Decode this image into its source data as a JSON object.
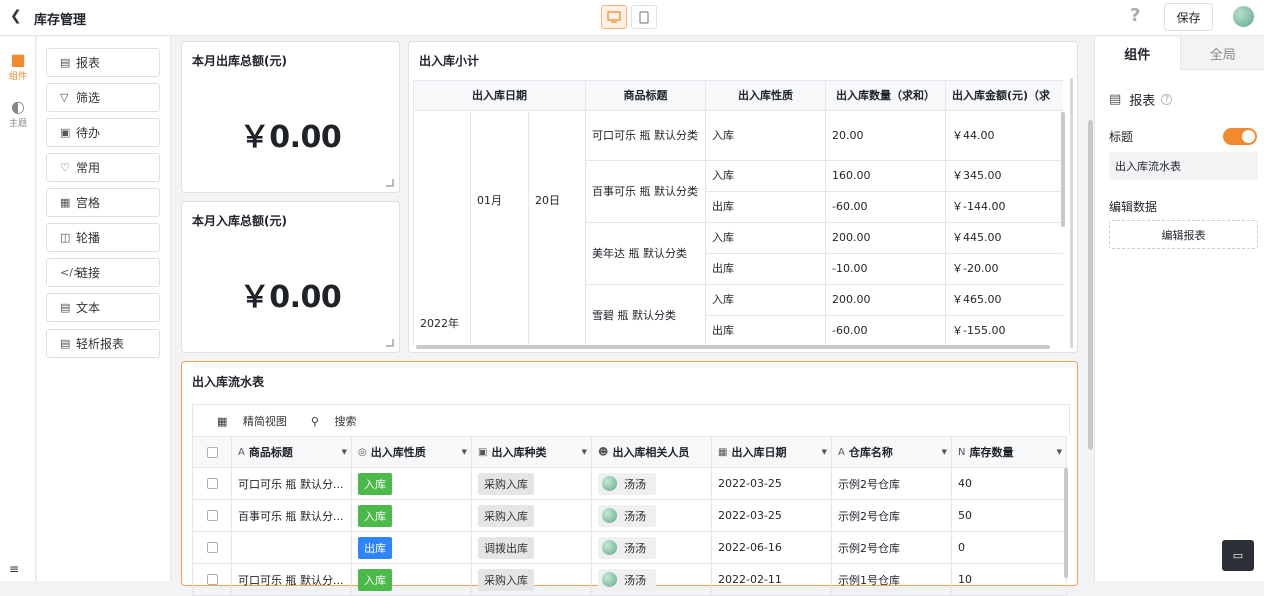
{
  "header": {
    "back_icon": "chevron-left-icon",
    "title": "库存管理",
    "help": "?",
    "save_label": "保存"
  },
  "rail": {
    "items": [
      {
        "label": "组件",
        "icon": "puzzle-icon",
        "active": true
      },
      {
        "label": "主题",
        "icon": "palette-icon",
        "active": false
      }
    ],
    "collapse_icon": "collapse-icon"
  },
  "components": [
    {
      "label": "报表",
      "icon": "report-icon"
    },
    {
      "label": "筛选",
      "icon": "filter-icon"
    },
    {
      "label": "待办",
      "icon": "todo-icon"
    },
    {
      "label": "常用",
      "icon": "heart-icon"
    },
    {
      "label": "宫格",
      "icon": "grid-icon"
    },
    {
      "label": "轮播",
      "icon": "carousel-icon"
    },
    {
      "label": "链接",
      "icon": "link-icon"
    },
    {
      "label": "文本",
      "icon": "text-icon"
    },
    {
      "label": "轻析报表",
      "icon": "analysis-icon"
    }
  ],
  "cards": {
    "out_total": {
      "title": "本月出库总额(元)",
      "value": "￥0.00"
    },
    "in_total": {
      "title": "本月入库总额(元)",
      "value": "￥0.00"
    }
  },
  "summary": {
    "title": "出入库小计",
    "headers": [
      "出入库日期",
      "商品标题",
      "出入库性质",
      "出入库数量（求和）",
      "出入库金额(元)（求"
    ],
    "year": "2022年",
    "month": "01月",
    "day": "20日",
    "groups": [
      {
        "product": "可口可乐 瓶 默认分类",
        "rows": [
          {
            "type": "入库",
            "qty": "20.00",
            "amount": "￥44.00"
          }
        ]
      },
      {
        "product": "百事可乐 瓶 默认分类",
        "rows": [
          {
            "type": "入库",
            "qty": "160.00",
            "amount": "￥345.00"
          },
          {
            "type": "出库",
            "qty": "-60.00",
            "amount": "￥-144.00"
          }
        ]
      },
      {
        "product": "美年达 瓶 默认分类",
        "rows": [
          {
            "type": "入库",
            "qty": "200.00",
            "amount": "￥445.00"
          },
          {
            "type": "出库",
            "qty": "-10.00",
            "amount": "￥-20.00"
          }
        ]
      },
      {
        "product": "雪碧 瓶 默认分类",
        "rows": [
          {
            "type": "入库",
            "qty": "200.00",
            "amount": "￥465.00"
          },
          {
            "type": "出库",
            "qty": "-60.00",
            "amount": "￥-155.00"
          }
        ]
      }
    ]
  },
  "flow": {
    "title": "出入库流水表",
    "toolbar": {
      "view_label": "精简视图",
      "search_label": "搜索"
    },
    "columns": [
      "商品标题",
      "出入库性质",
      "出入库种类",
      "出入库相关人员",
      "出入库日期",
      "仓库名称",
      "库存数量"
    ],
    "rows": [
      {
        "product": "可口可乐 瓶 默认分...",
        "nature": "入库",
        "kind": "采购入库",
        "person": "汤汤",
        "date": "2022-03-25",
        "warehouse": "示例2号仓库",
        "stock": "40"
      },
      {
        "product": "百事可乐 瓶 默认分...",
        "nature": "入库",
        "kind": "采购入库",
        "person": "汤汤",
        "date": "2022-03-25",
        "warehouse": "示例2号仓库",
        "stock": "50"
      },
      {
        "product": "",
        "nature": "出库",
        "kind": "调拨出库",
        "person": "汤汤",
        "date": "2022-06-16",
        "warehouse": "示例2号仓库",
        "stock": "0"
      },
      {
        "product": "可口可乐 瓶 默认分...",
        "nature": "入库",
        "kind": "采购入库",
        "person": "汤汤",
        "date": "2022-02-11",
        "warehouse": "示例1号仓库",
        "stock": "10"
      }
    ]
  },
  "panel": {
    "tab_component": "组件",
    "tab_global": "全局",
    "section": "报表",
    "title_label": "标题",
    "title_enabled": true,
    "title_value": "出入库流水表",
    "edit_data_label": "编辑数据",
    "edit_report_label": "编辑报表"
  },
  "colors": {
    "accent": "#f08a2c",
    "in_tag": "#4cb94b",
    "out_tag": "#2e86ff"
  }
}
